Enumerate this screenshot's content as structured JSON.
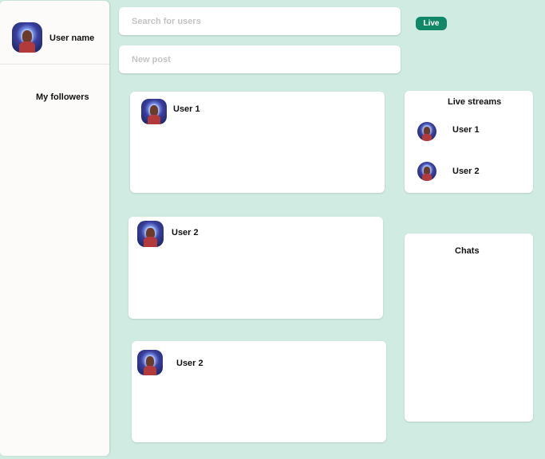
{
  "sidebar": {
    "profile": {
      "username": "User name"
    },
    "followers_label": "My followers"
  },
  "header": {
    "search": {
      "placeholder": "Search for users"
    },
    "new_post": {
      "placeholder": "New post"
    },
    "live_badge": "Live"
  },
  "feed": {
    "posts": [
      {
        "author": "User 1"
      },
      {
        "author": "User 2"
      },
      {
        "author": "User 2"
      }
    ]
  },
  "live_streams": {
    "title": "Live streams",
    "items": [
      {
        "name": "User 1"
      },
      {
        "name": "User 2"
      }
    ]
  },
  "chats": {
    "title": "Chats"
  },
  "colors": {
    "background": "#d0ebe2",
    "card": "#ffffff",
    "sidebar": "#fdfbfa",
    "accent": "#118768"
  }
}
